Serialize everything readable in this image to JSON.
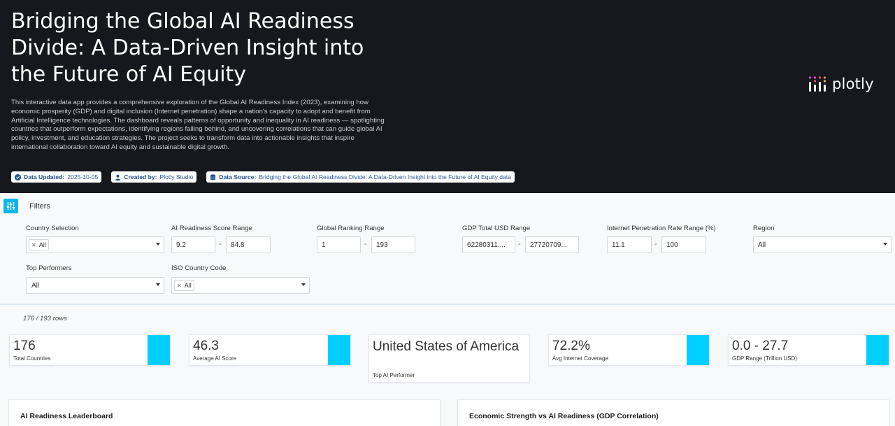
{
  "header": {
    "title": "Bridging the Global AI Readiness Divide: A Data-Driven Insight into the Future of AI Equity",
    "description": "This interactive data app provides a comprehensive exploration of the Global AI Readiness Index (2023), examining how economic prosperity (GDP) and digital inclusion (Internet penetration) shape a nation's capacity to adopt and benefit from Artificial Intelligence technologies. The dashboard reveals patterns of opportunity and inequality in AI readiness — spotlighting countries that outperform expectations, identifying regions falling behind, and uncovering correlations that can guide global AI policy, investment, and education strategies. The project seeks to transform data into actionable insights that inspire international collaboration toward AI equity and sustainable digital growth.",
    "badges": {
      "updated_key": "Data Updated:",
      "updated_val": "2025-10-05",
      "created_key": "Created by:",
      "created_val": "Plotly Studio",
      "source_key": "Data Source:",
      "source_val": "Bridging the Global AI Readiness Divide: A Data-Driven Insight into the Future of AI Equity data"
    },
    "logo_text": "plotly"
  },
  "filters": {
    "label": "Filters",
    "country": {
      "label": "Country Selection",
      "chip": "All"
    },
    "score": {
      "label": "AI Readiness Score Range",
      "min": "9.2",
      "max": "84.8"
    },
    "ranking": {
      "label": "Global Ranking Range",
      "min": "1",
      "max": "193"
    },
    "gdp": {
      "label": "GDP Total USD Range",
      "min": "62280311....",
      "max": "27720709..."
    },
    "internet": {
      "label": "Internet Penetration Rate Range (%)",
      "min": "11.1",
      "max": "100"
    },
    "region": {
      "label": "Region",
      "value": "All"
    },
    "top": {
      "label": "Top Performers",
      "value": "All"
    },
    "iso": {
      "label": "ISO Country Code",
      "chip": "All"
    },
    "separator": "-"
  },
  "stats": {
    "rows": "176 / 193 rows",
    "cards": [
      {
        "value": "176",
        "label": "Total Countries"
      },
      {
        "value": "46.3",
        "label": "Average AI Score"
      },
      {
        "value": "United States of America",
        "label": "Top AI Performer"
      },
      {
        "value": "72.2%",
        "label": "Avg Internet Coverage"
      },
      {
        "value": "0.0 - 27.7",
        "label": "GDP Range (Trillion USD)"
      }
    ]
  },
  "panels": {
    "leaderboard_title": "AI Readiness Leaderboard",
    "gdp_title": "Economic Strength vs AI Readiness (GDP Correlation)"
  },
  "colors": {
    "accent": "#00cfff",
    "header_bg": "#16181d",
    "filter_icon": "#0fb5e8"
  }
}
